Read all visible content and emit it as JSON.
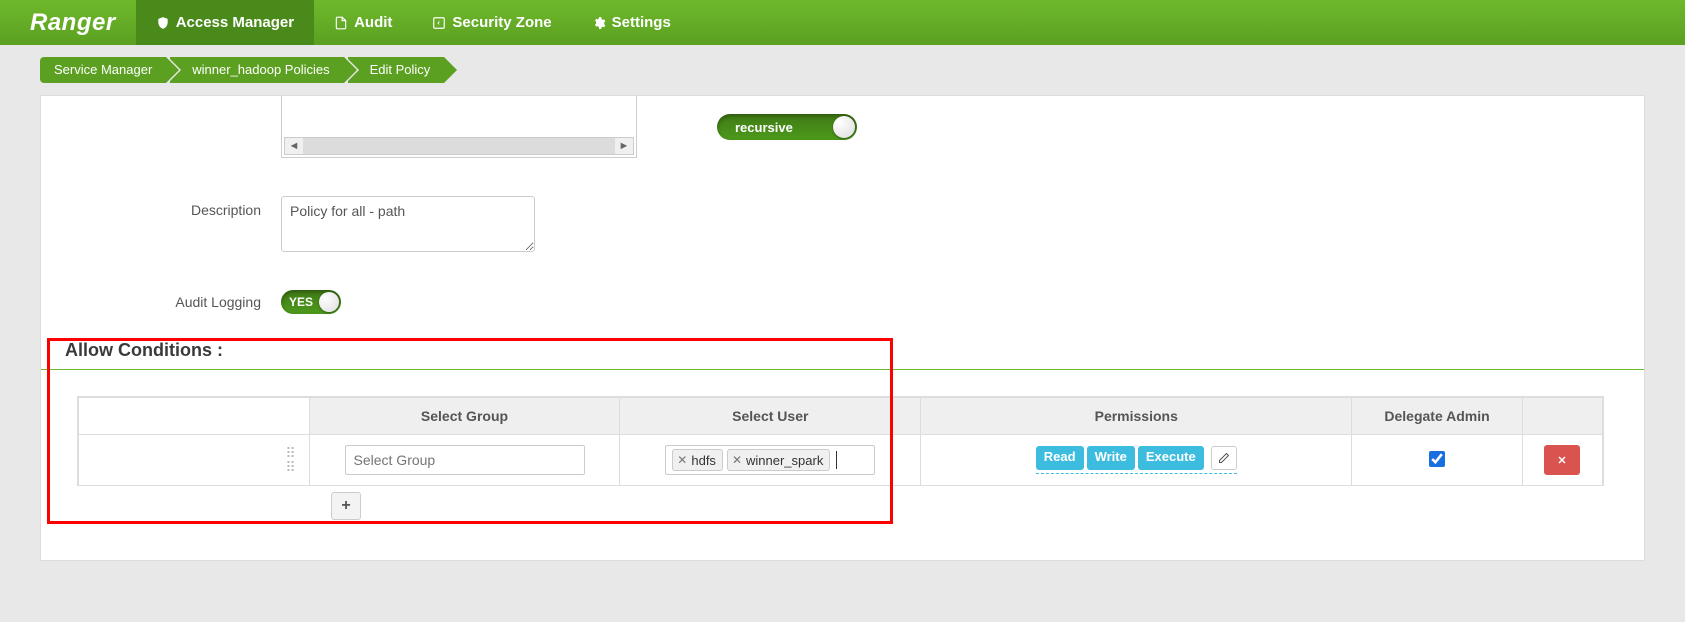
{
  "app": {
    "name": "Ranger"
  },
  "nav": {
    "access_manager": "Access Manager",
    "audit": "Audit",
    "security_zone": "Security Zone",
    "settings": "Settings"
  },
  "breadcrumbs": {
    "service_manager": "Service Manager",
    "policies": "winner_hadoop Policies",
    "edit": "Edit Policy"
  },
  "form": {
    "recursive_label": "recursive",
    "description_label": "Description",
    "description_value": "Policy for all - path",
    "audit_logging_label": "Audit Logging",
    "audit_yes": "YES"
  },
  "allow": {
    "title": "Allow Conditions :",
    "columns": {
      "group": "Select Group",
      "user": "Select User",
      "permissions": "Permissions",
      "delegate": "Delegate Admin"
    },
    "row": {
      "group_placeholder": "Select Group",
      "users": [
        "hdfs",
        "winner_spark"
      ],
      "permissions": [
        "Read",
        "Write",
        "Execute"
      ],
      "delegate_checked": true
    }
  }
}
